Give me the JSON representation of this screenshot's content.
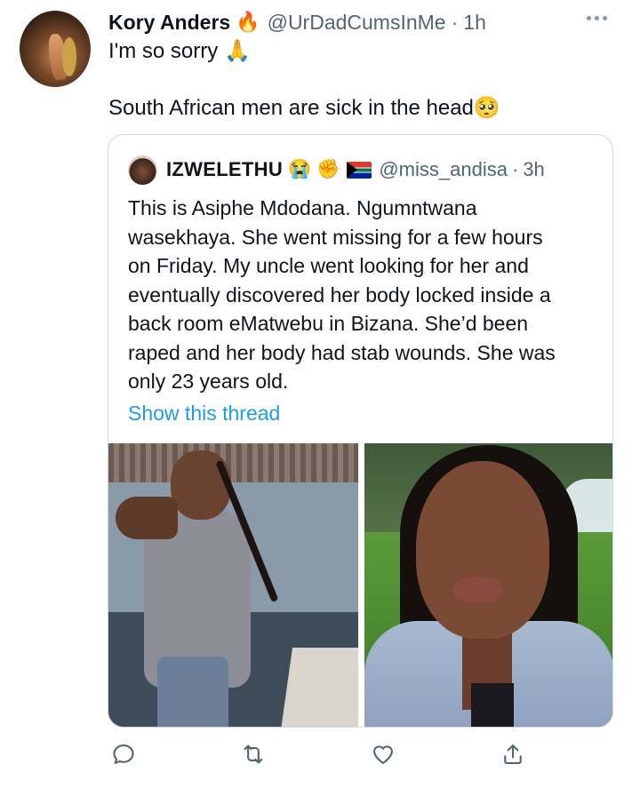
{
  "tweet": {
    "author_name": "Kory Anders",
    "author_emoji": "🔥",
    "handle": "@UrDadCumsInMe",
    "separator": "·",
    "time": "1h",
    "line1": "I'm so sorry",
    "line1_emoji": "🙏",
    "line2": "South African men are sick in the head",
    "line2_emoji": "🥺"
  },
  "quoted": {
    "author_name": "IZWELETHU",
    "emoji1": "😭",
    "emoji2": "✊",
    "handle": "@miss_andisa",
    "separator": "·",
    "time": "3h",
    "text_lines": [
      "This is Asiphe Mdodana. Ngumntwana",
      "wasekhaya. She went missing for a few hours",
      "on Friday. My uncle went looking for her and",
      "eventually discovered her body locked inside a",
      "back room eMatwebu in Bizana. She’d been",
      "raped and her body had stab wounds. She was",
      "only 23 years old."
    ],
    "show_thread": "Show this thread"
  },
  "actions": {
    "reply_icon": "reply-icon",
    "retweet_icon": "retweet-icon",
    "like_icon": "like-icon",
    "share_icon": "share-icon"
  },
  "colors": {
    "link": "#1d9bf0",
    "secondary": "#536471",
    "border": "#cfd9de"
  }
}
